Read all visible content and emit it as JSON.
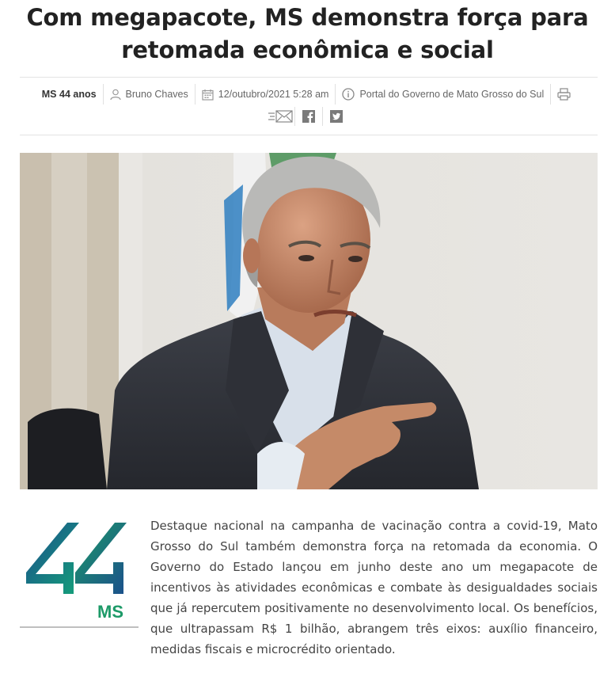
{
  "article": {
    "title": "Com megapacote, MS demonstra força para retomada econômica e social",
    "body": "Destaque nacional na campanha de vacinação contra a covid-19, Mato Grosso do Sul também demonstra força na retomada da economia. O Governo do Estado lançou em junho deste ano um megapacote de incentivos às atividades econômicas e combate às desigualdades sociais que já repercutem positivamente no desenvolvimento local. Os benefícios, que ultrapassam R$ 1 bilhão, abrangem três eixos: auxílio financeiro, medidas fiscais e microcrédito orientado."
  },
  "meta": {
    "category": "MS 44 anos",
    "author": "Bruno Chaves",
    "date": "12/outubro/2021 5:28 am",
    "source": "Portal do Governo de Mato Grosso do Sul"
  },
  "icons": {
    "author": "user-icon",
    "date": "calendar-icon",
    "source": "info-icon",
    "print": "printer-icon",
    "email": "envelope-icon",
    "facebook": "facebook-icon",
    "twitter": "twitter-icon"
  },
  "logo": {
    "text": "MS",
    "colors": {
      "green": "#1d9a68",
      "blue": "#1b4f8c"
    }
  }
}
